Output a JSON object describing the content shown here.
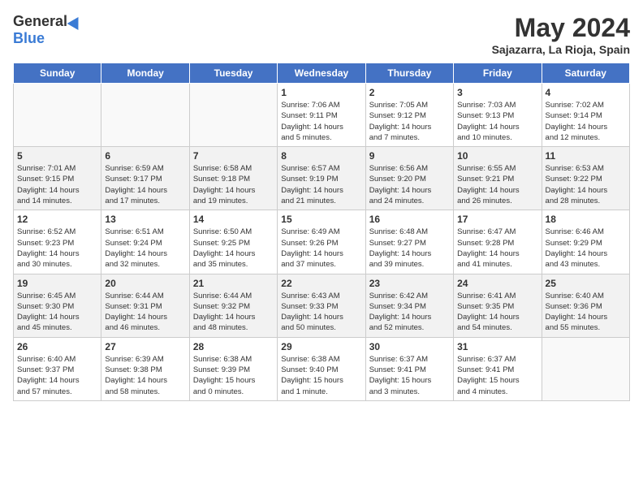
{
  "header": {
    "logo_general": "General",
    "logo_blue": "Blue",
    "month_title": "May 2024",
    "location": "Sajazarra, La Rioja, Spain"
  },
  "weekdays": [
    "Sunday",
    "Monday",
    "Tuesday",
    "Wednesday",
    "Thursday",
    "Friday",
    "Saturday"
  ],
  "weeks": [
    [
      {
        "day": "",
        "info": ""
      },
      {
        "day": "",
        "info": ""
      },
      {
        "day": "",
        "info": ""
      },
      {
        "day": "1",
        "info": "Sunrise: 7:06 AM\nSunset: 9:11 PM\nDaylight: 14 hours\nand 5 minutes."
      },
      {
        "day": "2",
        "info": "Sunrise: 7:05 AM\nSunset: 9:12 PM\nDaylight: 14 hours\nand 7 minutes."
      },
      {
        "day": "3",
        "info": "Sunrise: 7:03 AM\nSunset: 9:13 PM\nDaylight: 14 hours\nand 10 minutes."
      },
      {
        "day": "4",
        "info": "Sunrise: 7:02 AM\nSunset: 9:14 PM\nDaylight: 14 hours\nand 12 minutes."
      }
    ],
    [
      {
        "day": "5",
        "info": "Sunrise: 7:01 AM\nSunset: 9:15 PM\nDaylight: 14 hours\nand 14 minutes."
      },
      {
        "day": "6",
        "info": "Sunrise: 6:59 AM\nSunset: 9:17 PM\nDaylight: 14 hours\nand 17 minutes."
      },
      {
        "day": "7",
        "info": "Sunrise: 6:58 AM\nSunset: 9:18 PM\nDaylight: 14 hours\nand 19 minutes."
      },
      {
        "day": "8",
        "info": "Sunrise: 6:57 AM\nSunset: 9:19 PM\nDaylight: 14 hours\nand 21 minutes."
      },
      {
        "day": "9",
        "info": "Sunrise: 6:56 AM\nSunset: 9:20 PM\nDaylight: 14 hours\nand 24 minutes."
      },
      {
        "day": "10",
        "info": "Sunrise: 6:55 AM\nSunset: 9:21 PM\nDaylight: 14 hours\nand 26 minutes."
      },
      {
        "day": "11",
        "info": "Sunrise: 6:53 AM\nSunset: 9:22 PM\nDaylight: 14 hours\nand 28 minutes."
      }
    ],
    [
      {
        "day": "12",
        "info": "Sunrise: 6:52 AM\nSunset: 9:23 PM\nDaylight: 14 hours\nand 30 minutes."
      },
      {
        "day": "13",
        "info": "Sunrise: 6:51 AM\nSunset: 9:24 PM\nDaylight: 14 hours\nand 32 minutes."
      },
      {
        "day": "14",
        "info": "Sunrise: 6:50 AM\nSunset: 9:25 PM\nDaylight: 14 hours\nand 35 minutes."
      },
      {
        "day": "15",
        "info": "Sunrise: 6:49 AM\nSunset: 9:26 PM\nDaylight: 14 hours\nand 37 minutes."
      },
      {
        "day": "16",
        "info": "Sunrise: 6:48 AM\nSunset: 9:27 PM\nDaylight: 14 hours\nand 39 minutes."
      },
      {
        "day": "17",
        "info": "Sunrise: 6:47 AM\nSunset: 9:28 PM\nDaylight: 14 hours\nand 41 minutes."
      },
      {
        "day": "18",
        "info": "Sunrise: 6:46 AM\nSunset: 9:29 PM\nDaylight: 14 hours\nand 43 minutes."
      }
    ],
    [
      {
        "day": "19",
        "info": "Sunrise: 6:45 AM\nSunset: 9:30 PM\nDaylight: 14 hours\nand 45 minutes."
      },
      {
        "day": "20",
        "info": "Sunrise: 6:44 AM\nSunset: 9:31 PM\nDaylight: 14 hours\nand 46 minutes."
      },
      {
        "day": "21",
        "info": "Sunrise: 6:44 AM\nSunset: 9:32 PM\nDaylight: 14 hours\nand 48 minutes."
      },
      {
        "day": "22",
        "info": "Sunrise: 6:43 AM\nSunset: 9:33 PM\nDaylight: 14 hours\nand 50 minutes."
      },
      {
        "day": "23",
        "info": "Sunrise: 6:42 AM\nSunset: 9:34 PM\nDaylight: 14 hours\nand 52 minutes."
      },
      {
        "day": "24",
        "info": "Sunrise: 6:41 AM\nSunset: 9:35 PM\nDaylight: 14 hours\nand 54 minutes."
      },
      {
        "day": "25",
        "info": "Sunrise: 6:40 AM\nSunset: 9:36 PM\nDaylight: 14 hours\nand 55 minutes."
      }
    ],
    [
      {
        "day": "26",
        "info": "Sunrise: 6:40 AM\nSunset: 9:37 PM\nDaylight: 14 hours\nand 57 minutes."
      },
      {
        "day": "27",
        "info": "Sunrise: 6:39 AM\nSunset: 9:38 PM\nDaylight: 14 hours\nand 58 minutes."
      },
      {
        "day": "28",
        "info": "Sunrise: 6:38 AM\nSunset: 9:39 PM\nDaylight: 15 hours\nand 0 minutes."
      },
      {
        "day": "29",
        "info": "Sunrise: 6:38 AM\nSunset: 9:40 PM\nDaylight: 15 hours\nand 1 minute."
      },
      {
        "day": "30",
        "info": "Sunrise: 6:37 AM\nSunset: 9:41 PM\nDaylight: 15 hours\nand 3 minutes."
      },
      {
        "day": "31",
        "info": "Sunrise: 6:37 AM\nSunset: 9:41 PM\nDaylight: 15 hours\nand 4 minutes."
      },
      {
        "day": "",
        "info": ""
      }
    ]
  ]
}
